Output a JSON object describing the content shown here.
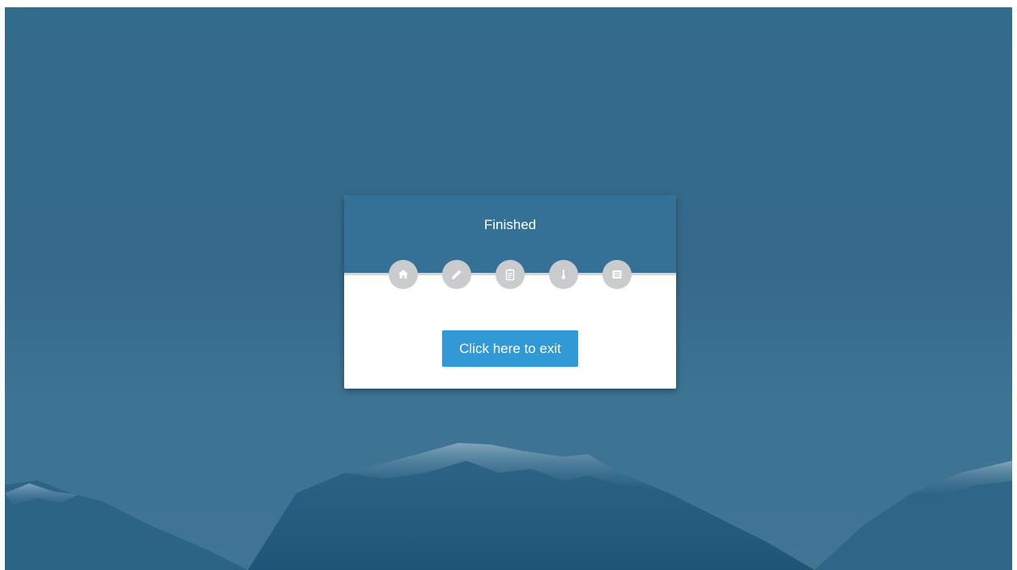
{
  "dialog": {
    "title": "Finished",
    "exit_label": "Click here to exit"
  },
  "steps": [
    {
      "icon": "home-icon"
    },
    {
      "icon": "pencil-icon"
    },
    {
      "icon": "clipboard-icon"
    },
    {
      "icon": "thermometer-icon"
    },
    {
      "icon": "list-icon"
    }
  ],
  "colors": {
    "background": "#336b8a",
    "header": "#357196",
    "button": "#3199d6",
    "step_circle": "#c9cbcc",
    "step_line": "#d3d5d6"
  }
}
